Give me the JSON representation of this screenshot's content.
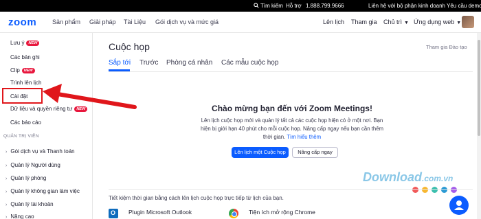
{
  "topbar": {
    "search": "Tìm kiếm",
    "support": "Hỗ trợ",
    "phone": "1.888.799.9666",
    "contact_sales": "Liên hệ với bộ phận kinh doanh",
    "request_demo": "Yêu cầu demo"
  },
  "nav": {
    "logo": "zoom",
    "products": "Sản phẩm",
    "solutions": "Giải pháp",
    "resources": "Tài Liệu",
    "plans": "Gói dịch vụ và mức giá",
    "schedule": "Lên lịch",
    "join": "Tham gia",
    "host": "Chủ trì",
    "web_app": "Ứng dụng web"
  },
  "sidebar": {
    "new_badge": "NEW",
    "items": [
      {
        "label": "Lưu ý",
        "badge": true
      },
      {
        "label": "Các bản ghi"
      },
      {
        "label": "Clip",
        "badge": true
      },
      {
        "label": "Trình lên lịch"
      },
      {
        "label": "Cài đặt"
      },
      {
        "label": "Dữ liệu và quyền riêng tư",
        "badge": true
      },
      {
        "label": "Các báo cáo"
      }
    ],
    "admin_section": "QUẢN TRỊ VIÊN",
    "admin_items": [
      "Gói dịch vụ và Thanh toán",
      "Quản lý Người dùng",
      "Quản lý phòng",
      "Quản lý không gian làm việc",
      "Quản lý tài khoản",
      "Nâng cao"
    ]
  },
  "main": {
    "title": "Cuộc họp",
    "join_training": "Tham gia Đào tạo",
    "tabs": [
      "Sắp tới",
      "Trước",
      "Phòng cá nhân",
      "Các mẫu cuộc họp"
    ],
    "welcome_title": "Chào mừng bạn đến với Zoom Meetings!",
    "welcome_line1": "Lên lịch cuộc họp mới và quản lý tất cả các cuộc họp hiện có ở một nơi. Bạn",
    "welcome_line2": "hiện bị giới hạn 40 phút cho mỗi cuộc họp. Nâng cấp ngay nếu bạn cần thêm",
    "welcome_line3": "thời gian.",
    "learn_more": "Tìm hiểu thêm",
    "schedule_button": "Lên lịch một Cuộc họp",
    "upgrade_button": "Nâng cấp ngay",
    "hint": "Tiết kiệm thời gian bằng cách lên lịch cuộc họp trực tiếp từ lịch của bạn.",
    "outlook_plugin": "Plugin Microsoft Outlook",
    "chrome_extension": "Tiện ích mở rộng Chrome"
  },
  "watermark": {
    "text": "Download",
    "domain": ".com.vn",
    "dot_colors": [
      "#f15a5a",
      "#f7b731",
      "#3cbfae",
      "#2b9bd4",
      "#a55eea"
    ]
  },
  "colors": {
    "accent": "#0b5cff",
    "highlight": "#e0161b",
    "badge": "#e8173d"
  }
}
